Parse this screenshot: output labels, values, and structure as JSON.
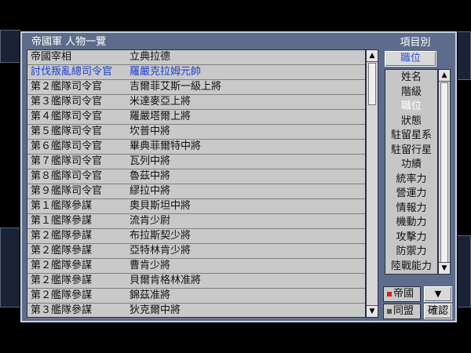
{
  "window": {
    "title": "帝國軍 人物一覽"
  },
  "people": [
    {
      "post": "帝國宰相",
      "name": "立典拉德"
    },
    {
      "post": "討伐叛亂總司令官",
      "name": "羅嚴克拉姆元帥"
    },
    {
      "post": "第２艦隊司令官",
      "name": "吉爾菲艾斯一級上將"
    },
    {
      "post": "第３艦隊司令官",
      "name": "米達麥亞上將"
    },
    {
      "post": "第４艦隊司令官",
      "name": "羅嚴塔爾上將"
    },
    {
      "post": "第５艦隊司令官",
      "name": "坎普中將"
    },
    {
      "post": "第６艦隊司令官",
      "name": "畢典菲爾特中將"
    },
    {
      "post": "第７艦隊司令官",
      "name": "瓦列中將"
    },
    {
      "post": "第８艦隊司令官",
      "name": "魯茲中將"
    },
    {
      "post": "第９艦隊司令官",
      "name": "繆拉中將"
    },
    {
      "post": "第１艦隊參謀",
      "name": "奧貝斯坦中將"
    },
    {
      "post": "第１艦隊參謀",
      "name": "流肯少尉"
    },
    {
      "post": "第２艦隊參謀",
      "name": "布拉斯契少將"
    },
    {
      "post": "第２艦隊參謀",
      "name": "亞特林肯少將"
    },
    {
      "post": "第２艦隊參謀",
      "name": "曹肯少將"
    },
    {
      "post": "第２艦隊參謀",
      "name": "貝爾肯格林准將"
    },
    {
      "post": "第２艦隊參謀",
      "name": "錦茲准將"
    },
    {
      "post": "第３艦隊參謀",
      "name": "狄克爾中將"
    }
  ],
  "sidebar": {
    "label": "項目別",
    "current": "職位",
    "items": [
      "姓名",
      "階級",
      "職位",
      "狀態",
      "駐留星系",
      "駐留行星",
      "功績",
      "統率力",
      "營運力",
      "情報力",
      "機動力",
      "攻擊力",
      "防禦力",
      "陸戰能力"
    ],
    "active_index": 2
  },
  "factions": {
    "empire": "帝國",
    "alliance": "同盟",
    "selected": "empire"
  },
  "buttons": {
    "down": "▼",
    "ok": "確認",
    "scroll_up": "▲",
    "scroll_down": "▼"
  },
  "colors": {
    "panel": "#5e6c8c",
    "list_bg": "#c9c9c9",
    "highlight_text": "#1a3fd6"
  }
}
